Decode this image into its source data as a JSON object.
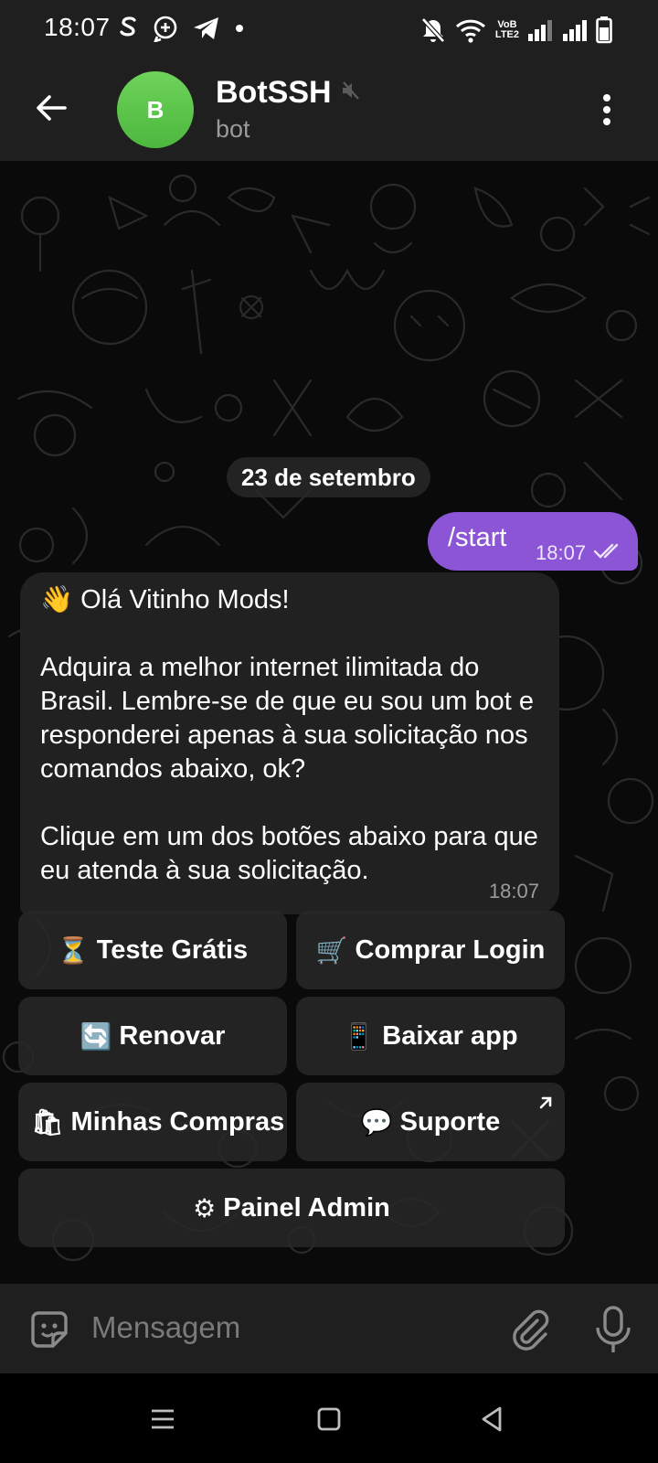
{
  "status_bar": {
    "time": "18:07",
    "left_icons": [
      "skype-icon",
      "signal-chat-icon",
      "telegram-icon",
      "dot-icon"
    ],
    "volte_label": "VoB\nLTE2",
    "right_icons": [
      "mute-notifications-icon",
      "wifi-icon",
      "signal-bars-icon",
      "battery-icon"
    ]
  },
  "header": {
    "avatar_letter": "B",
    "title": "BotSSH",
    "subtitle": "bot",
    "muted": true,
    "avatar_color": "#4cb73e"
  },
  "chat": {
    "date_chip": "23 de setembro",
    "outgoing": {
      "text": "/start",
      "time": "18:07",
      "read": true
    },
    "incoming": {
      "text": "👋 Olá Vitinho Mods!\n\nAdquira a melhor internet ilimitada do Brasil. Lembre-se de que eu sou um bot e responderei apenas à sua solicitação nos comandos abaixo, ok?\n\nClique em um dos botões abaixo para que eu atenda à sua solicitação.",
      "time": "18:07"
    },
    "keyboard": [
      {
        "emoji": "⏳",
        "label": "Teste Grátis"
      },
      {
        "emoji": "🛒",
        "label": "Comprar Login"
      },
      {
        "emoji": "🔄",
        "label": "Renovar"
      },
      {
        "emoji": "📱",
        "label": "Baixar app"
      },
      {
        "emoji": "🛍",
        "label": "Minhas Compras"
      },
      {
        "emoji": "💬",
        "label": "Suporte",
        "external_link": true
      },
      {
        "emoji": "⚙",
        "label": "Painel Admin"
      }
    ]
  },
  "input_bar": {
    "placeholder": "Mensagem"
  },
  "colors": {
    "accent_bubble": "#8b55d6",
    "incoming_bubble": "#212121",
    "header_bg": "#1f1f1f"
  }
}
